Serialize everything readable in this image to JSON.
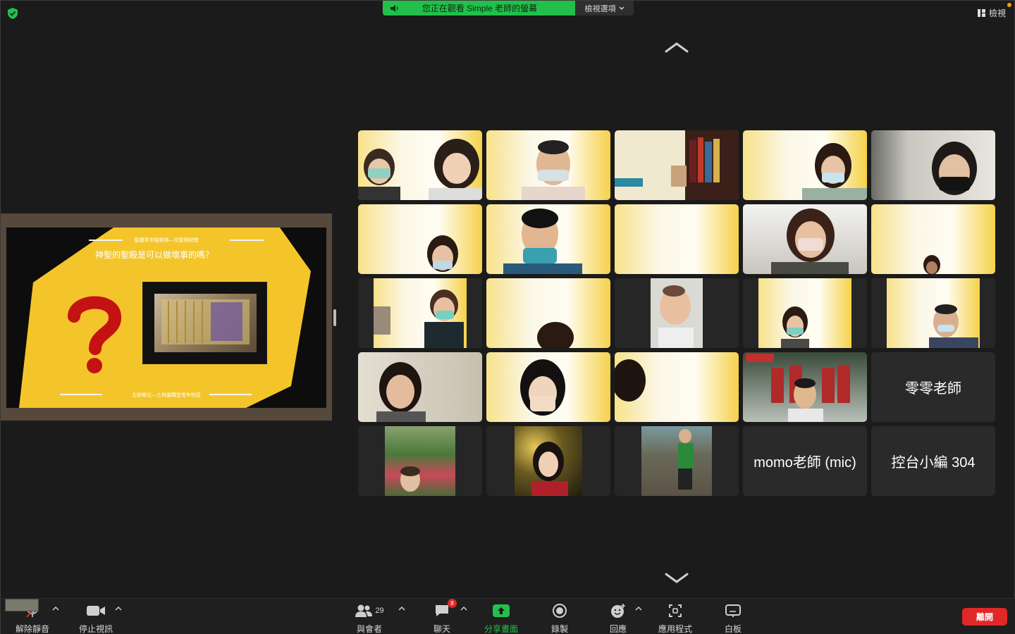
{
  "top": {
    "banner_text": "您正在觀看 Simple 老師的螢幕",
    "view_options_label": "檢視選項",
    "view_label": "檢視"
  },
  "slide": {
    "header": "板橋青年服務隊—兒童理財營",
    "question": "神聖的聖殿是可以做壞事的嗎？",
    "footer": "主辦單位—士林靈糧堂青年牧區"
  },
  "gallery": {
    "tiles": [
      {
        "kind": "video",
        "active": true
      },
      {
        "kind": "video"
      },
      {
        "kind": "video"
      },
      {
        "kind": "video"
      },
      {
        "kind": "video"
      },
      {
        "kind": "video"
      },
      {
        "kind": "video"
      },
      {
        "kind": "video"
      },
      {
        "kind": "video"
      },
      {
        "kind": "video"
      },
      {
        "kind": "video"
      },
      {
        "kind": "video"
      },
      {
        "kind": "video"
      },
      {
        "kind": "video"
      },
      {
        "kind": "video"
      },
      {
        "kind": "video"
      },
      {
        "kind": "video"
      },
      {
        "kind": "video"
      },
      {
        "kind": "video"
      },
      {
        "kind": "name",
        "name": "零零老師"
      },
      {
        "kind": "photo"
      },
      {
        "kind": "photo"
      },
      {
        "kind": "photo"
      },
      {
        "kind": "name",
        "name": "momo老師 (mic)"
      },
      {
        "kind": "name",
        "name": "控台小編 304"
      }
    ]
  },
  "toolbar": {
    "unmute_label": "解除靜音",
    "stop_video_label": "停止視訊",
    "participants_label": "與會者",
    "participants_count": "29",
    "chat_label": "聊天",
    "chat_badge": "8",
    "share_label": "分享畫面",
    "record_label": "錄製",
    "reactions_label": "回應",
    "apps_label": "應用程式",
    "whiteboard_label": "白板",
    "leave_label": "離開"
  },
  "colors": {
    "accent_green": "#22c04a",
    "leave_red": "#e02828",
    "slide_yellow": "#f4c52a"
  }
}
